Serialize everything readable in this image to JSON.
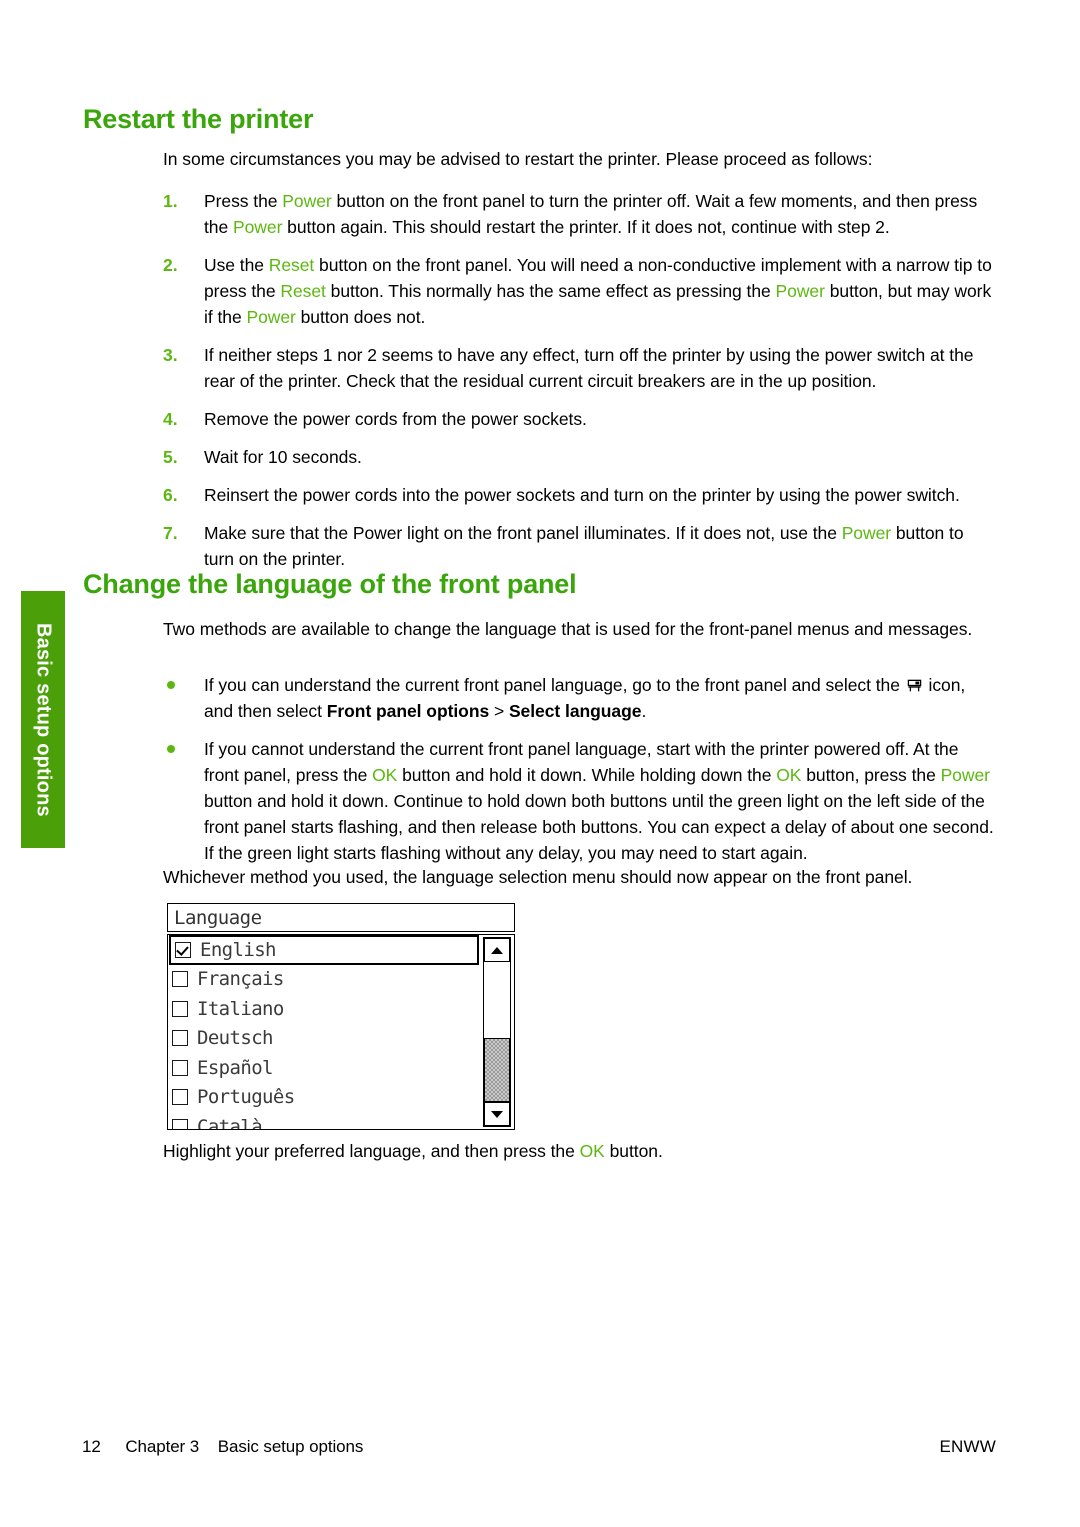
{
  "side_tab": {
    "label": "Basic setup options",
    "color": "#4ba00a"
  },
  "accent_color": "#3ba50c",
  "inline_green": "#5cb811",
  "sections": {
    "restart": {
      "title": "Restart the printer",
      "intro": "In some circumstances you may be advised to restart the printer. Please proceed as follows:",
      "steps": [
        {
          "number": "1.",
          "parts": [
            {
              "t": "Press the ",
              "s": "plain"
            },
            {
              "t": "Power",
              "s": "green"
            },
            {
              "t": " button on the front panel to turn the printer off. Wait a few moments, and then press the ",
              "s": "plain"
            },
            {
              "t": "Power",
              "s": "green"
            },
            {
              "t": " button again. This should restart the printer. If it does not, continue with step 2.",
              "s": "plain"
            }
          ]
        },
        {
          "number": "2.",
          "parts": [
            {
              "t": "Use the ",
              "s": "plain"
            },
            {
              "t": "Reset",
              "s": "green"
            },
            {
              "t": " button on the front panel. You will need a non-conductive implement with a narrow tip to press the ",
              "s": "plain"
            },
            {
              "t": "Reset",
              "s": "green"
            },
            {
              "t": " button. This normally has the same effect as pressing the ",
              "s": "plain"
            },
            {
              "t": "Power",
              "s": "green"
            },
            {
              "t": " button, but may work if the ",
              "s": "plain"
            },
            {
              "t": "Power",
              "s": "green"
            },
            {
              "t": " button does not.",
              "s": "plain"
            }
          ]
        },
        {
          "number": "3.",
          "parts": [
            {
              "t": "If neither steps 1 nor 2 seems to have any effect, turn off the printer by using the power switch at the rear of the printer. Check that the residual current circuit breakers are in the up position.",
              "s": "plain"
            }
          ]
        },
        {
          "number": "4.",
          "parts": [
            {
              "t": "Remove the power cords from the power sockets.",
              "s": "plain"
            }
          ]
        },
        {
          "number": "5.",
          "parts": [
            {
              "t": "Wait for 10 seconds.",
              "s": "plain"
            }
          ]
        },
        {
          "number": "6.",
          "parts": [
            {
              "t": "Reinsert the power cords into the power sockets and turn on the printer by using the power switch.",
              "s": "plain"
            }
          ]
        },
        {
          "number": "7.",
          "parts": [
            {
              "t": "Make sure that the Power light on the front panel illuminates. If it does not, use the ",
              "s": "plain"
            },
            {
              "t": "Power",
              "s": "green"
            },
            {
              "t": " button to turn on the printer.",
              "s": "plain"
            }
          ]
        }
      ]
    },
    "language": {
      "title": "Change the language of the front panel",
      "intro": "Two methods are available to change the language that is used for the front-panel menus and messages.",
      "bullets": [
        {
          "parts": [
            {
              "t": "If you can understand the current front panel language, go to the front panel and select the ",
              "s": "plain"
            },
            {
              "t": "",
              "s": "icon",
              "icon": "front-panel-setup-icon"
            },
            {
              "t": " icon, and then select ",
              "s": "plain"
            },
            {
              "t": "Front panel options",
              "s": "bold"
            },
            {
              "t": " > ",
              "s": "plain"
            },
            {
              "t": "Select language",
              "s": "bold"
            },
            {
              "t": ".",
              "s": "plain"
            }
          ]
        },
        {
          "parts": [
            {
              "t": "If you cannot understand the current front panel language, start with the printer powered off. At the front panel, press the ",
              "s": "plain"
            },
            {
              "t": "OK",
              "s": "green"
            },
            {
              "t": " button and hold it down. While holding down the ",
              "s": "plain"
            },
            {
              "t": "OK",
              "s": "green"
            },
            {
              "t": " button, press the ",
              "s": "plain"
            },
            {
              "t": "Power",
              "s": "green"
            },
            {
              "t": " button and hold it down. Continue to hold down both buttons until the green light on the left side of the front panel starts flashing, and then release both buttons. You can expect a delay of about one second. If the green light starts flashing without any delay, you may need to start again.",
              "s": "plain"
            }
          ]
        }
      ],
      "after_bullets": "Whichever method you used, the language selection menu should now appear on the front panel.",
      "caption_parts": [
        {
          "t": "Highlight your preferred language, and then press the ",
          "s": "plain"
        },
        {
          "t": "OK",
          "s": "green"
        },
        {
          "t": " button.",
          "s": "plain"
        }
      ]
    }
  },
  "front_panel_dialog": {
    "title": "Language",
    "items": [
      {
        "label": "English",
        "checked": true,
        "selected": true
      },
      {
        "label": "Français",
        "checked": false,
        "selected": false
      },
      {
        "label": "Italiano",
        "checked": false,
        "selected": false
      },
      {
        "label": "Deutsch",
        "checked": false,
        "selected": false
      },
      {
        "label": "Español",
        "checked": false,
        "selected": false
      },
      {
        "label": "Português",
        "checked": false,
        "selected": false
      },
      {
        "label": "Català",
        "checked": false,
        "selected": false
      }
    ],
    "scrollbar": {
      "up_arrow": "▲",
      "down_arrow": "▼"
    }
  },
  "footer": {
    "page_number": "12",
    "chapter": "Chapter 3",
    "chapter_title": "Basic setup options",
    "locale": "ENWW"
  }
}
